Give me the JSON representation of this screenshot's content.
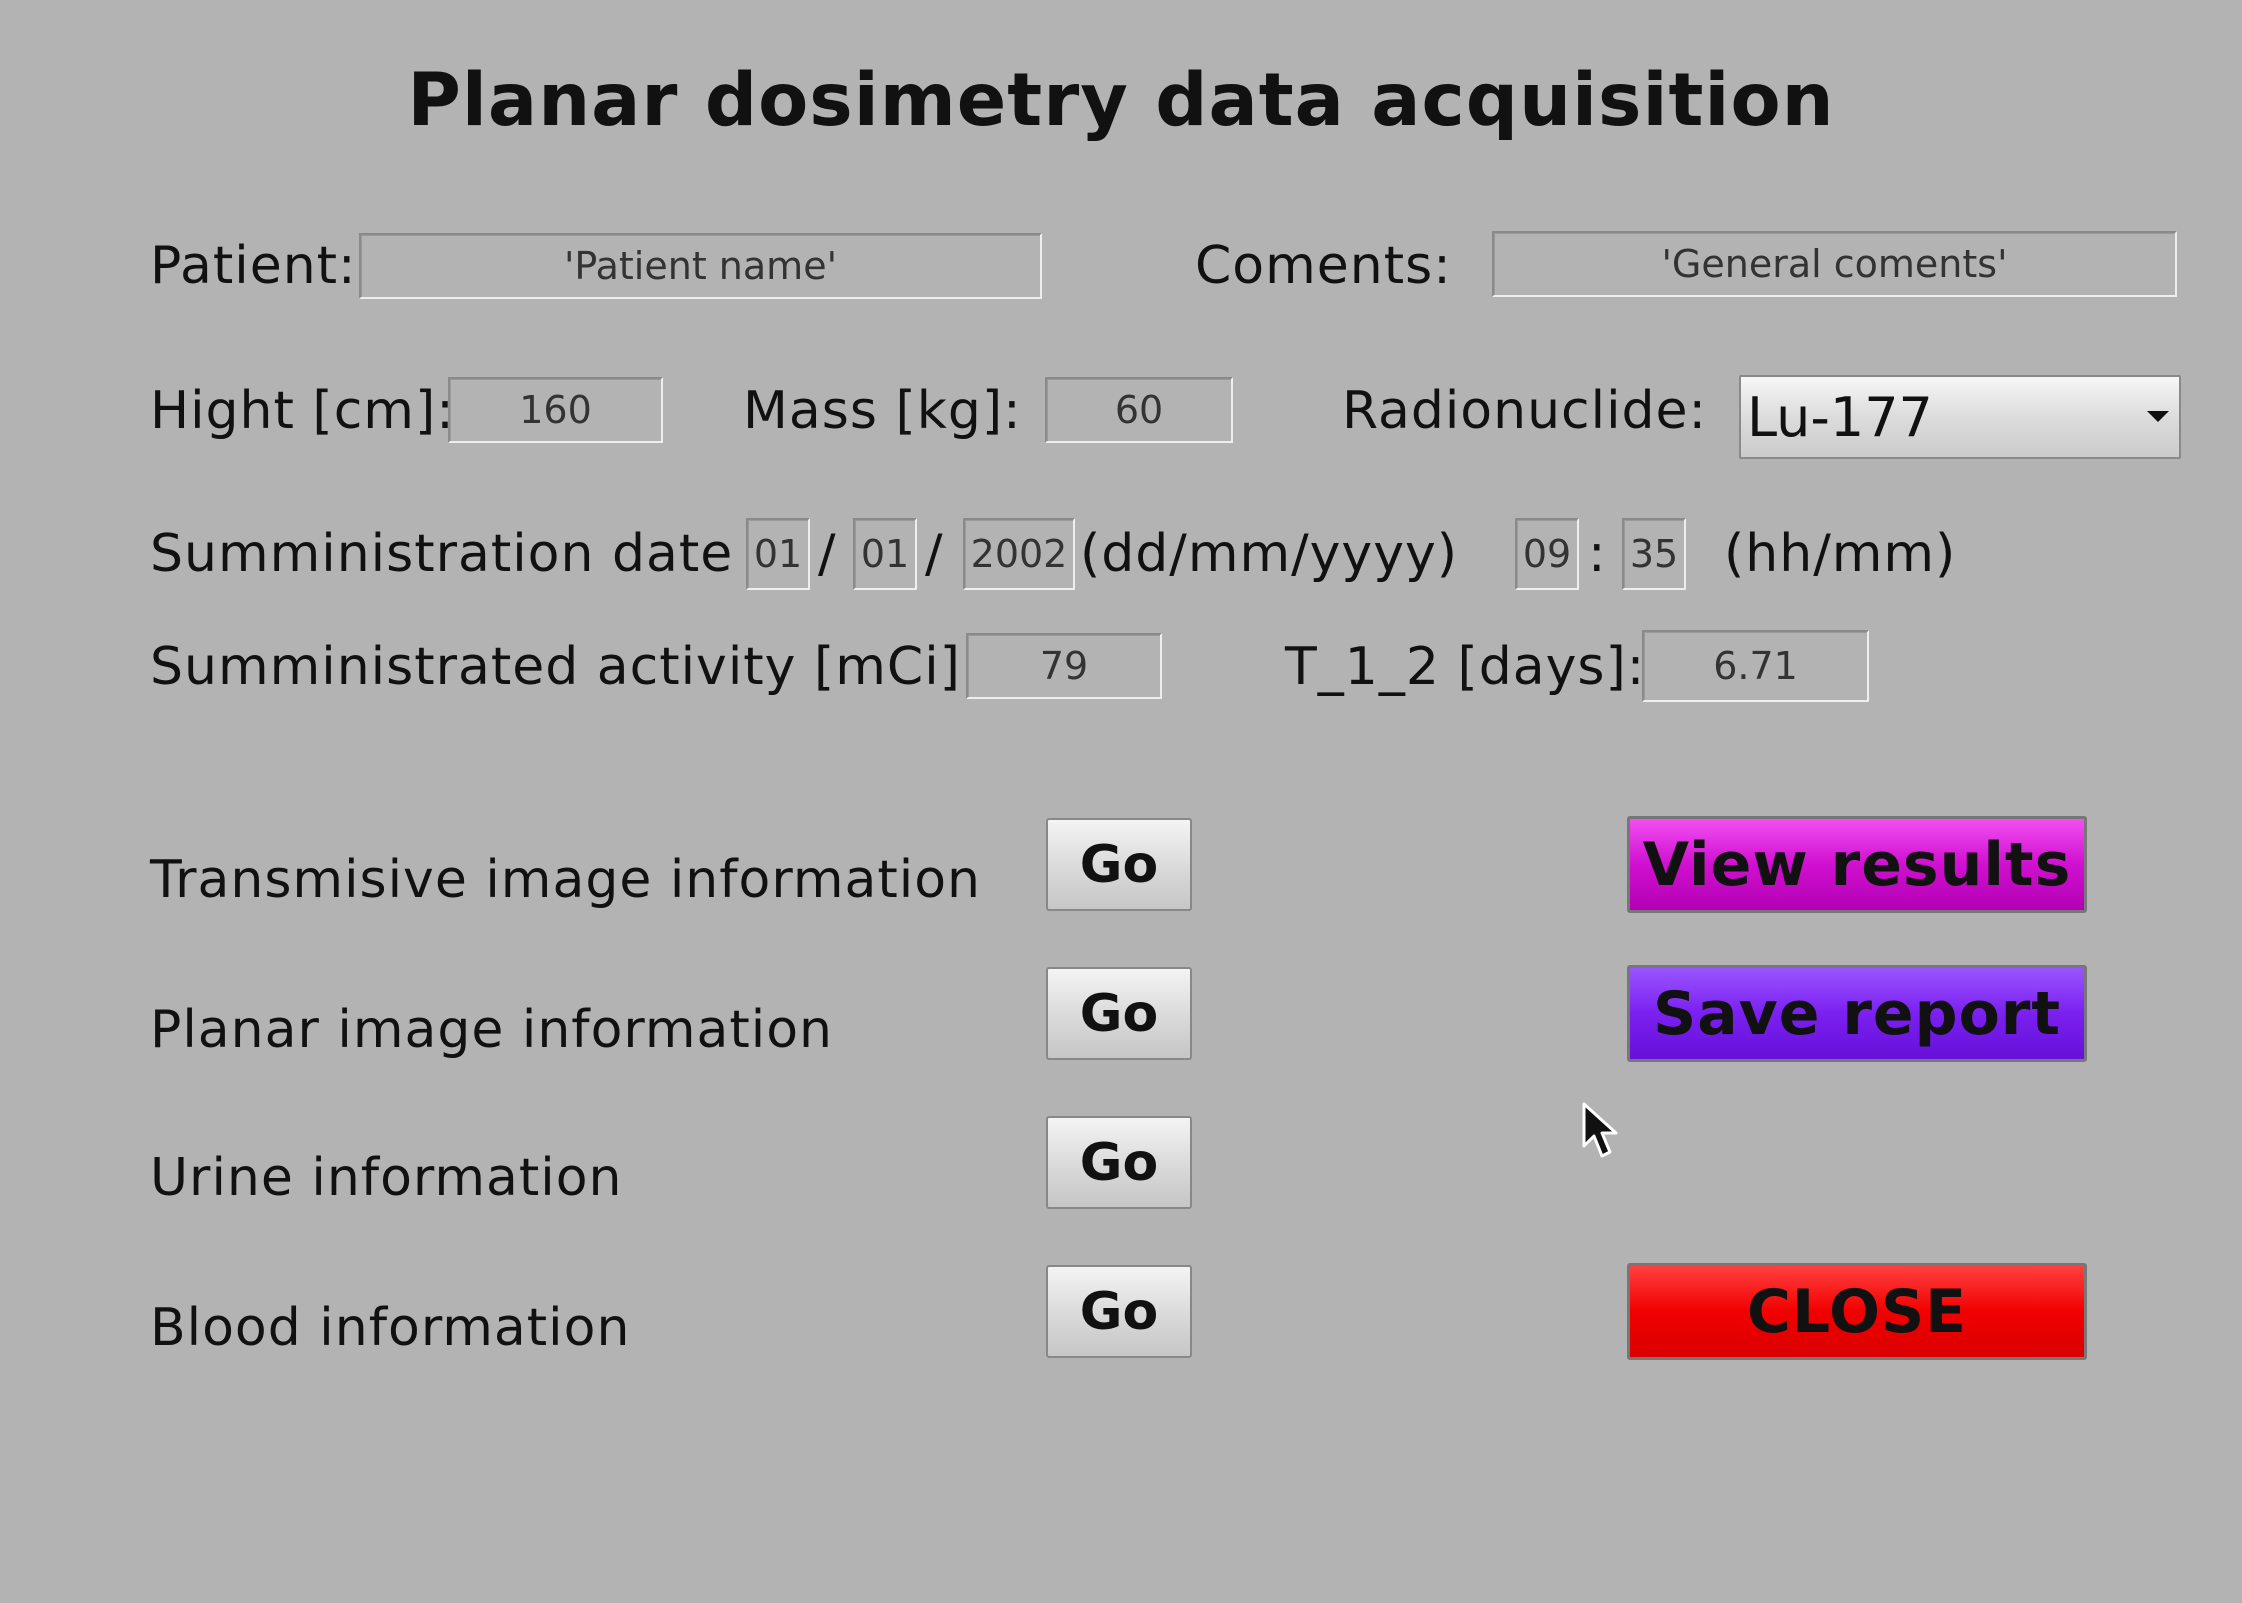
{
  "title": "Planar dosimetry data acquisition",
  "patient": {
    "label": "Patient:",
    "value": "'Patient name'"
  },
  "comments": {
    "label": "Coments:",
    "value": "'General coments'"
  },
  "height": {
    "label": "Hight [cm]:",
    "value": "160"
  },
  "mass": {
    "label": "Mass [kg]:",
    "value": "60"
  },
  "radionuclide": {
    "label": "Radionuclide:",
    "selected": "Lu-177"
  },
  "admin_date": {
    "label": "Sumministration date",
    "day": "01",
    "month": "01",
    "year": "2002",
    "sep": "/",
    "date_format": "(dd/mm/yyyy)",
    "hour": "09",
    "minute": "35",
    "time_sep": ":",
    "time_format": "(hh/mm)"
  },
  "activity": {
    "label": "Sumministrated activity [mCi]:",
    "value": "79"
  },
  "half_life": {
    "label": "T_1_2 [days]:",
    "value": "6.71"
  },
  "sections": [
    {
      "label": "Transmisive image information",
      "button": "Go"
    },
    {
      "label": "Planar image information",
      "button": "Go"
    },
    {
      "label": "Urine information",
      "button": "Go"
    },
    {
      "label": "Blood information",
      "button": "Go"
    }
  ],
  "actions": {
    "view_results": "View results",
    "save_report": "Save report",
    "close": "CLOSE"
  },
  "colors": {
    "background": "#b3b3b3",
    "view_results": "#d010d0",
    "save_report": "#7a20f0",
    "close": "#f20000"
  },
  "icons": {
    "cursor": "mouse-pointer-icon",
    "dropdown": "chevron-down-icon"
  }
}
